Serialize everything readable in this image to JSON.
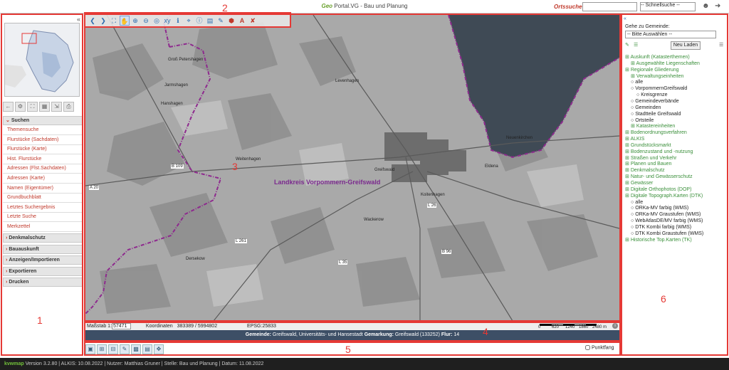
{
  "header": {
    "brand_geo": "Geo",
    "brand_rest": "Portal.VG - Bau und Planung",
    "ortsuche_label": "Ortssuche :",
    "ortsuche_value": "",
    "schnellsuche": "-- Schnellsuche --"
  },
  "annotations": {
    "n1": "1",
    "n2": "2",
    "n3": "3",
    "n4": "4",
    "n5": "5",
    "n6": "6"
  },
  "sidebar": {
    "collapse": "«",
    "suchen": "Suchen",
    "items": [
      "Themensuche",
      "Flurstücke (Sachdaten)",
      "Flurstücke (Karte)",
      "Hist. Flurstücke",
      "Adressen (Flst.Sachdaten)",
      "Adressen (Karte)",
      "Namen (Eigentümer)",
      "Grundbuchblatt",
      "Letztes Suchergebnis",
      "Letzte Suche",
      "Merkzettel"
    ],
    "panels": [
      "Denkmalschutz",
      "Bauauskunft",
      "Anzeigen/Importieren",
      "Exportieren",
      "Drucken"
    ]
  },
  "map": {
    "region_label": "Landkreis Vorpommern-Greifswald",
    "labels": [
      "Groß Petershagen",
      "Jarmshagen",
      "Hanshagen",
      "Greifswald",
      "Weitenhagen",
      "Levenhagen",
      "Neuenkirchen",
      "Wackerow",
      "Eldena",
      "Koitenhagen",
      "Dersekow",
      "B 109",
      "B 96",
      "L 26",
      "L 35",
      "L 261",
      "A 20"
    ]
  },
  "status": {
    "massstab_label": "Maßstab 1:",
    "massstab_value": "57471",
    "koord_label": "Koordinaten",
    "koord_value": "383389 / 5994802",
    "epsg": "EPSG:25833",
    "scale_ticks": [
      "0",
      "620",
      "1240",
      "1860",
      "2480 m"
    ]
  },
  "infobar": {
    "gemeinde_label": "Gemeinde:",
    "gemeinde_value": "Greifswald, Universitäts- und Hansestadt",
    "gemarkung_label": "Gemarkung:",
    "gemarkung_value": "Greifswald (133252)",
    "flur_label": "Flur:",
    "flur_value": "14"
  },
  "bottom": {
    "punktfang": "Punktfang"
  },
  "footer": {
    "logo": "kvwmap",
    "text": "Version 3.2.80 | ALKIS: 10.08.2022 | Nutzer: Matthias Gruner | Stelle: Bau und Planung | Datum: 11.08.2022"
  },
  "right": {
    "collapse": "«",
    "goto_label": "Gehe zu Gemeinde:",
    "goto_select": "-- Bitte Auswählen --",
    "neu_laden": "Neu Laden",
    "tree": [
      {
        "t": "Auskunft (Katasterthemen)",
        "l": 0,
        "c": "layer"
      },
      {
        "t": "Ausgewählte Liegenschaften",
        "l": 1,
        "c": "layer"
      },
      {
        "t": "Regionale Gliederung",
        "l": 0,
        "c": "layer"
      },
      {
        "t": "Verwaltungseinheiten",
        "l": 1,
        "c": "layer"
      },
      {
        "t": "alle",
        "l": 1,
        "c": "sub"
      },
      {
        "t": "VorpommernGreifswald",
        "l": 1,
        "c": "sub"
      },
      {
        "t": "Kreisgrenze",
        "l": 2,
        "c": "sub"
      },
      {
        "t": "Gemeindeverbände",
        "l": 1,
        "c": "sub"
      },
      {
        "t": "Gemeinden",
        "l": 1,
        "c": "sub"
      },
      {
        "t": "Stadtteile Greifswald",
        "l": 1,
        "c": "sub"
      },
      {
        "t": "Ortsteile",
        "l": 1,
        "c": "sub"
      },
      {
        "t": "Katastereinheiten",
        "l": 1,
        "c": "layer"
      },
      {
        "t": "Bodenordnungsverfahren",
        "l": 0,
        "c": "layer"
      },
      {
        "t": "ALKIS",
        "l": 0,
        "c": "layer"
      },
      {
        "t": "Grundstücksmarkt",
        "l": 0,
        "c": "layer"
      },
      {
        "t": "Bodenzustand und -nutzung",
        "l": 0,
        "c": "layer"
      },
      {
        "t": "Straßen und Verkehr",
        "l": 0,
        "c": "layer"
      },
      {
        "t": "Planen und Bauen",
        "l": 0,
        "c": "layer"
      },
      {
        "t": "Denkmalschutz",
        "l": 0,
        "c": "layer"
      },
      {
        "t": "Natur- und Gewässerschutz",
        "l": 0,
        "c": "layer"
      },
      {
        "t": "Gewässer",
        "l": 0,
        "c": "layer"
      },
      {
        "t": "Digitale Orthophotos (DOP)",
        "l": 0,
        "c": "layer"
      },
      {
        "t": "Digitale Topograph.Karten (DTK)",
        "l": 0,
        "c": "layer"
      },
      {
        "t": "alle",
        "l": 1,
        "c": "sub"
      },
      {
        "t": "ORKa-MV farbig (WMS)",
        "l": 1,
        "c": "sub"
      },
      {
        "t": "ORKa-MV Graustufen (WMS)",
        "l": 1,
        "c": "sub"
      },
      {
        "t": "WebAtlasDE/MV farbig (WMS)",
        "l": 1,
        "c": "sub"
      },
      {
        "t": "DTK Kombi farbig (WMS)",
        "l": 1,
        "c": "sub"
      },
      {
        "t": "DTK Kombi Graustufen (WMS)",
        "l": 1,
        "c": "sub"
      },
      {
        "t": "Historische Top.Karten (TK)",
        "l": 0,
        "c": "layer"
      }
    ]
  },
  "colors": {
    "accent": "#c0392b",
    "annotation": "#e53935",
    "infobar": "#3d4f66",
    "boundary": "#8e2a8e",
    "water": "#3f4a55"
  }
}
